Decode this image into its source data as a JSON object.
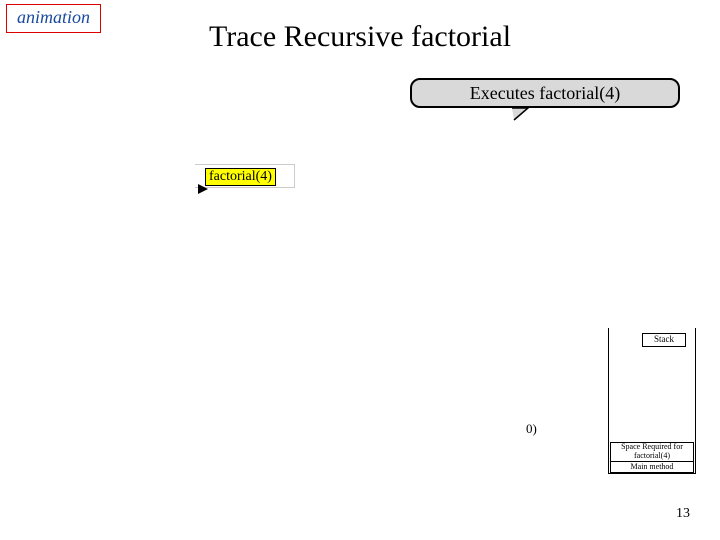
{
  "badge": {
    "text": "animation"
  },
  "title": "Trace Recursive factorial",
  "callout": {
    "text": "Executes factorial(4)"
  },
  "highlight": {
    "label": "factorial(4)"
  },
  "stray": {
    "text": "0)"
  },
  "stack": {
    "title": "Stack",
    "frames": [
      "Space Required for factorial(4)",
      "Main method"
    ]
  },
  "page_number": "13"
}
